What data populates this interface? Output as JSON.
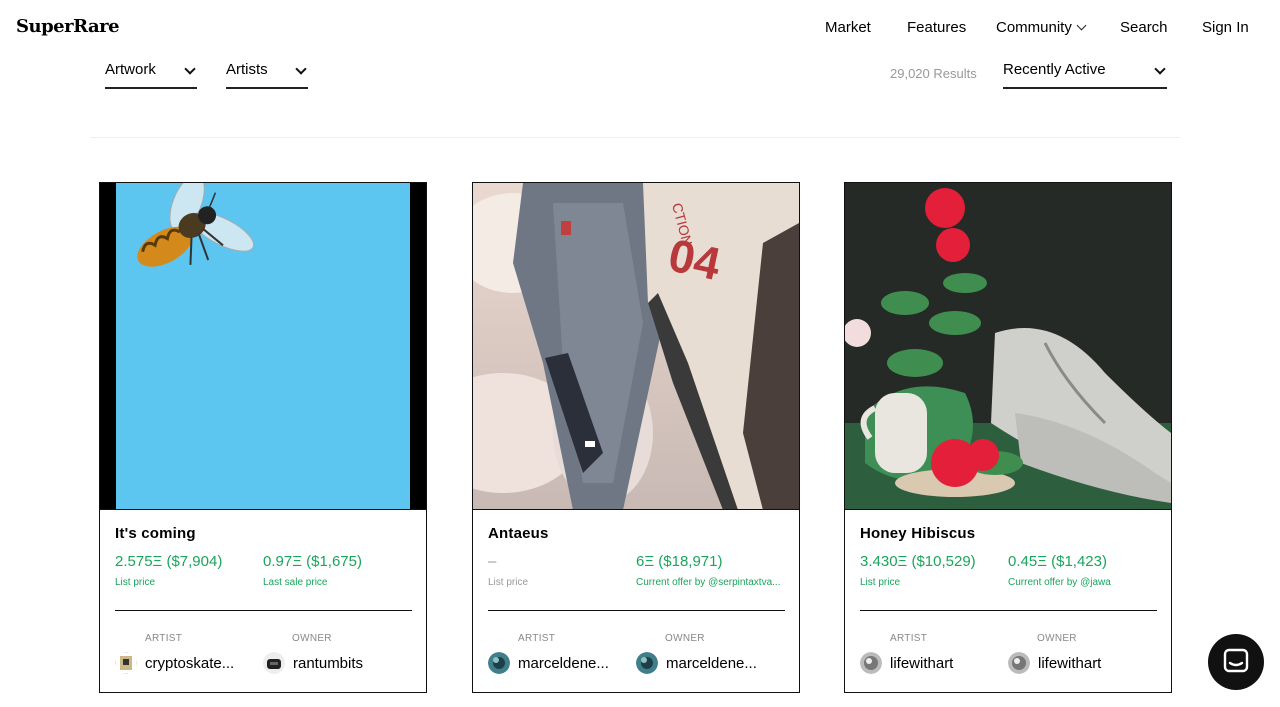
{
  "brand": {
    "logo": "SuperRare"
  },
  "nav": {
    "market": "Market",
    "features": "Features",
    "community": "Community",
    "search": "Search",
    "sign_in": "Sign In"
  },
  "filters": {
    "artwork": "Artwork",
    "artists": "Artists",
    "results": "29,020 Results",
    "sort": "Recently Active"
  },
  "cards": [
    {
      "title": "It's coming",
      "price1": "2.575Ξ ($7,904)",
      "label1": "List price",
      "price2": "0.97Ξ ($1,675)",
      "label2": "Last sale price",
      "artist_role": "ARTIST",
      "artist": "cryptoskate...",
      "owner_role": "OWNER",
      "owner": "rantumbits"
    },
    {
      "title": "Antaeus",
      "price1": "–",
      "label1": "List price",
      "price2": "6Ξ ($18,971)",
      "label2": "Current offer by @serpintaxtva...",
      "artist_role": "ARTIST",
      "artist": "marceldene...",
      "owner_role": "OWNER",
      "owner": "marceldene..."
    },
    {
      "title": "Honey Hibiscus",
      "price1": "3.430Ξ ($10,529)",
      "label1": "List price",
      "price2": "0.45Ξ ($1,423)",
      "label2": "Current offer by @jawa",
      "artist_role": "ARTIST",
      "artist": "lifewithart",
      "owner_role": "OWNER",
      "owner": "lifewithart"
    }
  ],
  "colors": {
    "price_green": "#1aa55d",
    "muted": "#999999",
    "border": "#111111"
  },
  "icons": {
    "chat": "chat-bubble-icon",
    "dropdown": "chevron-down-icon"
  }
}
